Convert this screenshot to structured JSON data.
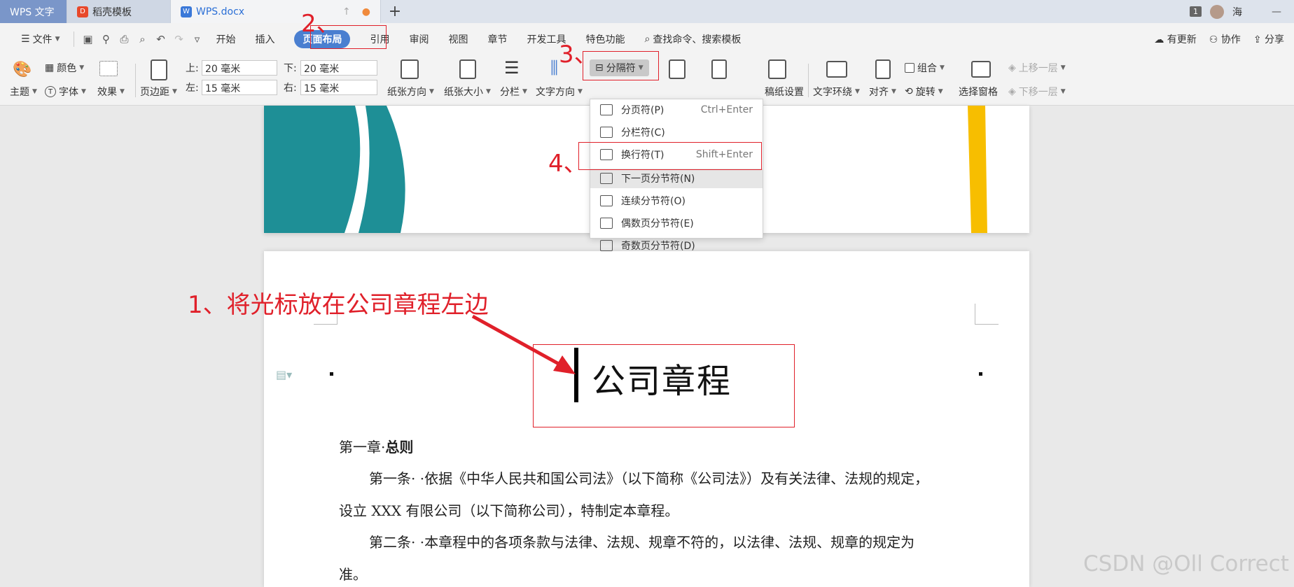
{
  "tabs": [
    {
      "label": "WPS 文字"
    },
    {
      "label": "稻壳模板"
    },
    {
      "label": "WPS.docx"
    }
  ],
  "titlebar_right": {
    "badge": "1",
    "user": "海",
    "minimize": "—"
  },
  "menu": {
    "file": "文件",
    "items": [
      "开始",
      "插入",
      "页面布局",
      "引用",
      "审阅",
      "视图",
      "章节",
      "开发工具",
      "特色功能"
    ],
    "active": "页面布局",
    "search": "查找命令、搜索模板",
    "right": [
      "有更新",
      "协作",
      "分享"
    ]
  },
  "ribbon": {
    "theme": "主题",
    "color": "颜色",
    "font": "字体",
    "effect": "效果",
    "margin": "页边距",
    "top_label": "上:",
    "top_value": "20 毫米",
    "bottom_label": "下:",
    "bottom_value": "20 毫米",
    "left_label": "左:",
    "left_value": "15 毫米",
    "right_label": "右:",
    "right_value": "15 毫米",
    "orientation": "纸张方向",
    "size": "纸张大小",
    "columns": "分栏",
    "text_direction": "文字方向",
    "separator": "分隔符",
    "paper_setup": "稿纸设置",
    "wrap": "文字环绕",
    "align": "对齐",
    "group": "组合",
    "rotate": "旋转",
    "select_pane": "选择窗格",
    "bring_forward": "上移一层",
    "send_backward": "下移一层"
  },
  "dropdown": [
    {
      "label": "分页符(P)",
      "shortcut": "Ctrl+Enter"
    },
    {
      "label": "分栏符(C)",
      "shortcut": ""
    },
    {
      "label": "换行符(T)",
      "shortcut": "Shift+Enter"
    },
    {
      "label": "下一页分节符(N)",
      "shortcut": ""
    },
    {
      "label": "连续分节符(O)",
      "shortcut": ""
    },
    {
      "label": "偶数页分节符(E)",
      "shortcut": ""
    },
    {
      "label": "奇数页分节符(D)",
      "shortcut": ""
    }
  ],
  "document": {
    "title": "公司章程",
    "chapter": "第一章",
    "chapter_title": "总则",
    "para1_line1": "第一条· ·依据《中华人民共和国公司法》（以下简称《公司法》）及有关法律、法规的规定，",
    "para1_line2": "设立 XXX 有限公司（以下简称公司），特制定本章程。",
    "para2_line1": "第二条· ·本章程中的各项条款与法律、法规、规章不符的，以法律、法规、规章的规定为",
    "para2_line2": "准。"
  },
  "annotations": {
    "step1": "1、将光标放在公司章程左边",
    "step2": "2、",
    "step3": "3、",
    "step4": "4、"
  },
  "watermark": "CSDN @Oll Correct",
  "colors": {
    "accent": "#4a7fd0",
    "annotation": "#e0202a",
    "teal": "#1e8f96",
    "yellow": "#f7be00"
  }
}
